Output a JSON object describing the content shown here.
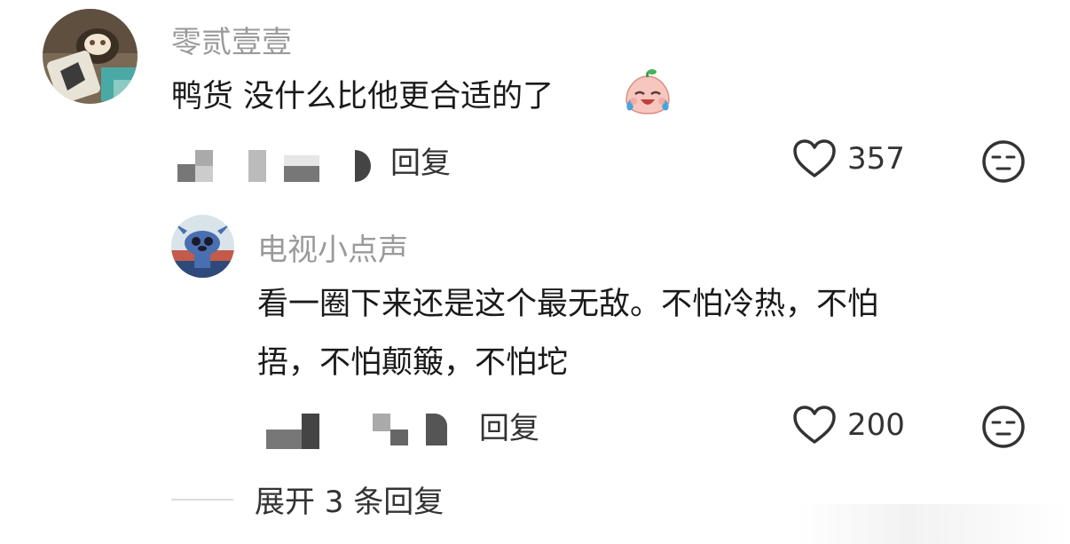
{
  "comments": [
    {
      "username": "零贰壹壹",
      "text": "鸭货 没什么比他更合适的了",
      "emoji": "crying-laughing-face-icon",
      "reply_label": "回复",
      "likes": "357"
    },
    {
      "username": "电视小点声",
      "text_line1": "看一圈下来还是这个最无敌。不怕冷热，不怕",
      "text_line2": "捂，不怕颠簸，不怕坨",
      "reply_label": "回复",
      "likes": "200"
    }
  ],
  "expand_replies": "展开 3 条回复",
  "colors": {
    "username": "#9a9a9a",
    "text": "#1a1a1a",
    "meta": "#333333",
    "divider": "#dddddd"
  }
}
